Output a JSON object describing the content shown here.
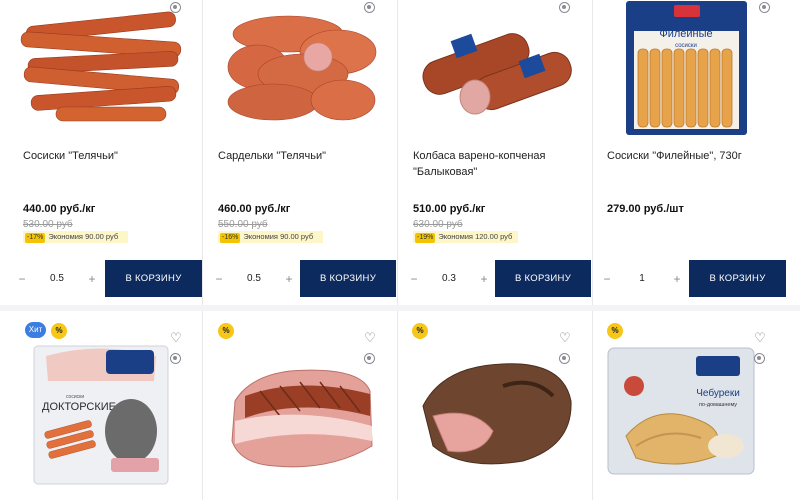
{
  "products": [
    {
      "name": "Сосиски \"Телячьи\"",
      "price": "440.00 руб./кг",
      "old_price": "530.00 руб",
      "discount_badge": "-17%",
      "savings": "Экономия 90.00 руб",
      "quantity": "0.5",
      "button_label": "В КОРЗИНУ"
    },
    {
      "name": "Сардельки \"Телячьи\"",
      "price": "460.00 руб./кг",
      "old_price": "550.00 руб",
      "discount_badge": "-16%",
      "savings": "Экономия 90.00 руб",
      "quantity": "0.5",
      "button_label": "В КОРЗИНУ"
    },
    {
      "name": "Колбаса варено-копченая \"Балыковая\"",
      "price": "510.00 руб./кг",
      "old_price": "630.00 руб",
      "discount_badge": "-19%",
      "savings": "Экономия 120.00 руб",
      "quantity": "0.3",
      "button_label": "В КОРЗИНУ"
    },
    {
      "name": "Сосиски \"Филейные\", 730г",
      "price": "279.00 руб./шт",
      "quantity": "1",
      "button_label": "В КОРЗИНУ"
    }
  ],
  "second_row": {
    "hit_badge": "Хит",
    "percent_badge": "%",
    "package_labels": {
      "doctor": "ДОКТОРСКИЕ",
      "doctor_sub": "сосиски",
      "chebureki": "Чебуреки",
      "chebureki_sub": "по-домашнему",
      "fileinye": "Филейные",
      "fileinye_sub": "сосиски"
    }
  },
  "stepper": {
    "minus": "−",
    "plus": "+"
  },
  "colors": {
    "cart_button": "#0c2a5e",
    "savings_bg": "#fdf6c9",
    "percent_badge": "#f6c619",
    "hit_badge": "#3b7de0"
  }
}
